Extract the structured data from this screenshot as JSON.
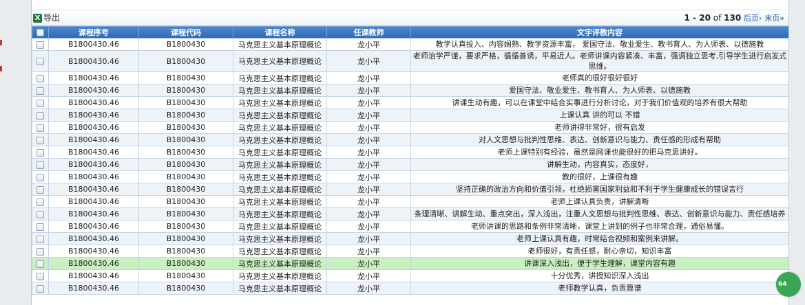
{
  "toolbar": {
    "export_label": "导出",
    "excel_icon": "excel-icon",
    "pager_range": "1 - 20",
    "pager_of": " of ",
    "pager_total": "130",
    "next_label": "后页›",
    "last_label": "末页»"
  },
  "columns": [
    "课程序号",
    "课程代码",
    "课程名称",
    "任课教师",
    "文字评教内容"
  ],
  "rows": [
    {
      "seq": "B1800430.46",
      "code": "B1800430",
      "name": "马克思主义基本原理概论",
      "teacher": "龙小平",
      "comment": "教学认真投入、内容娴熟、教学资源丰富， 爱国守法、敬业爱生、教书育人、为人师表、以德施教"
    },
    {
      "seq": "B1800430.46",
      "code": "B1800430",
      "name": "马克思主义基本原理概论",
      "teacher": "龙小平",
      "comment": "老师治学严谨，要求严格，循循善诱，平易近人。老师讲课内容紧凑、丰富，强调独立思考,引导学生进行启发式思维。"
    },
    {
      "seq": "B1800430.46",
      "code": "B1800430",
      "name": "马克思主义基本原理概论",
      "teacher": "龙小平",
      "comment": "老师真的很好很好很好"
    },
    {
      "seq": "B1800430.46",
      "code": "B1800430",
      "name": "马克思主义基本原理概论",
      "teacher": "龙小平",
      "comment": "爱国守法、敬业爱生、教书育人、为人师表、以德施教"
    },
    {
      "seq": "B1800430.46",
      "code": "B1800430",
      "name": "马克思主义基本原理概论",
      "teacher": "龙小平",
      "comment": "讲课生动有趣，可以在课堂中结合实事进行分析讨论，对于我们价值观的培养有很大帮助"
    },
    {
      "seq": "B1800430.46",
      "code": "B1800430",
      "name": "马克思主义基本原理概论",
      "teacher": "龙小平",
      "comment": "上课认真 讲的可以 不错"
    },
    {
      "seq": "B1800430.46",
      "code": "B1800430",
      "name": "马克思主义基本原理概论",
      "teacher": "龙小平",
      "comment": "老师讲得非常好，很有启发"
    },
    {
      "seq": "B1800430.46",
      "code": "B1800430",
      "name": "马克思主义基本原理概论",
      "teacher": "龙小平",
      "comment": "对人文思想与批判性思维、表达、创新意识与能力、责任感的形成有帮助"
    },
    {
      "seq": "B1800430.46",
      "code": "B1800430",
      "name": "马克思主义基本原理概论",
      "teacher": "龙小平",
      "comment": "老师上课特别有经验，虽然是网课也能很好的把马克思讲好。"
    },
    {
      "seq": "B1800430.46",
      "code": "B1800430",
      "name": "马克思主义基本原理概论",
      "teacher": "龙小平",
      "comment": "讲解生动，内容真实，态度好，"
    },
    {
      "seq": "B1800430.46",
      "code": "B1800430",
      "name": "马克思主义基本原理概论",
      "teacher": "龙小平",
      "comment": "教的很好，上课很有趣"
    },
    {
      "seq": "B1800430.46",
      "code": "B1800430",
      "name": "马克思主义基本原理概论",
      "teacher": "龙小平",
      "comment": "坚持正确的政治方向和价值引领，杜绝损害国家利益和不利于学生健康成长的错误言行"
    },
    {
      "seq": "B1800430.46",
      "code": "B1800430",
      "name": "马克思主义基本原理概论",
      "teacher": "龙小平",
      "comment": "老师上课认真负责，讲解清晰"
    },
    {
      "seq": "B1800430.46",
      "code": "B1800430",
      "name": "马克思主义基本原理概论",
      "teacher": "龙小平",
      "comment": "条理清晰、讲解生动、重点突出，深入浅出，注重人文思想与批判性思维、表达、创新意识与能力、责任感培养"
    },
    {
      "seq": "B1800430.46",
      "code": "B1800430",
      "name": "马克思主义基本原理概论",
      "teacher": "龙小平",
      "comment": "老师讲课的思路和条例非常清晰，课堂上讲到的例子也非常合理，通俗易懂。"
    },
    {
      "seq": "B1800430.46",
      "code": "B1800430",
      "name": "马克思主义基本原理概论",
      "teacher": "龙小平",
      "comment": "老师上课认真有趣，时常结合视频和案例来讲解。"
    },
    {
      "seq": "B1800430.46",
      "code": "B1800430",
      "name": "马克思主义基本原理概论",
      "teacher": "龙小平",
      "comment": "老师很好，有责任感，耐心亲切，知识丰富"
    },
    {
      "seq": "B1800430.46",
      "code": "B1800430",
      "name": "马克思主义基本原理概论",
      "teacher": "龙小平",
      "comment": "讲课深入浅出，便于学生理解，课堂内容有趣"
    },
    {
      "seq": "B1800430.46",
      "code": "B1800430",
      "name": "马克思主义基本原理概论",
      "teacher": "龙小平",
      "comment": "十分优秀，讲授知识深入浅出"
    },
    {
      "seq": "B1800430.46",
      "code": "B1800430",
      "name": "马克思主义基本原理概论",
      "teacher": "龙小平",
      "comment": "老师教学认真，负责靠谱"
    }
  ],
  "selected_row_index": 17,
  "badge_text": "64",
  "colors": {
    "header_blue": "#3a76c2",
    "row_alt": "#eef3f8",
    "row_selected": "#c8f0c0",
    "badge_green": "#3aa655",
    "link_blue": "#1a56b0"
  }
}
